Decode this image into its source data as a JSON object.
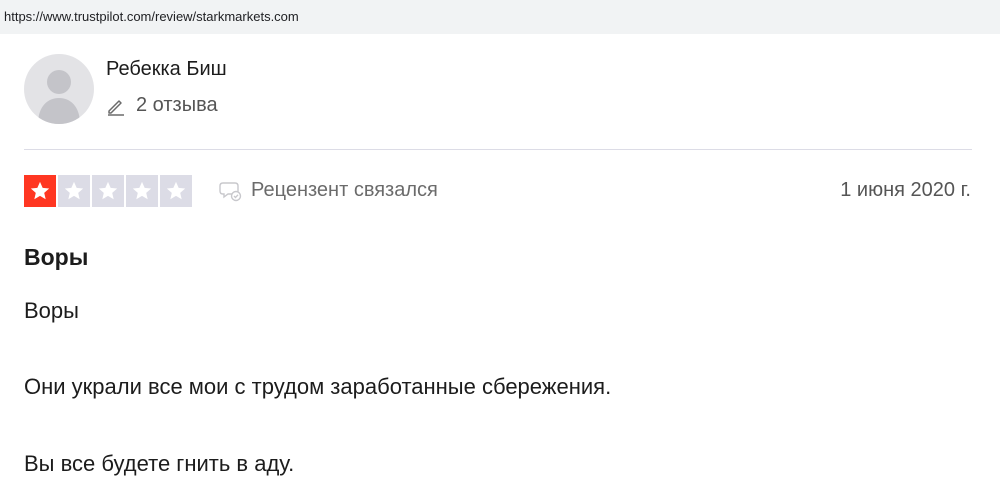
{
  "browser": {
    "url": "https://www.trustpilot.com/review/starkmarkets.com"
  },
  "reviewer": {
    "name": "Ребекка Биш",
    "reviews_count": "2 отзыва",
    "avatar_icon": "user-silhouette-icon"
  },
  "review": {
    "rating": 1,
    "max_rating": 5,
    "star_filled_color": "#ff3722",
    "star_empty_color": "#dcdce6",
    "contacted_label": "Рецензент связался",
    "date": "1 июня 2020 г.",
    "title": "Воры",
    "body": [
      "Воры",
      "Они украли все мои с трудом заработанные сбережения.",
      "Вы все будете гнить в аду."
    ]
  }
}
